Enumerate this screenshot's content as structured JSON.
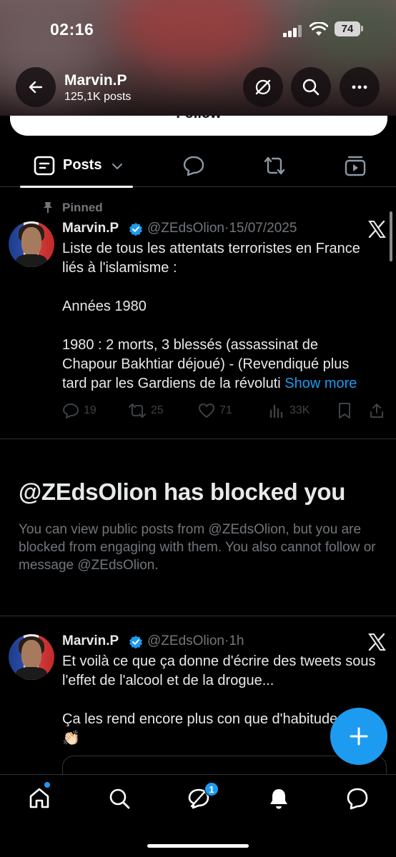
{
  "status_bar": {
    "time": "02:16",
    "battery": "74"
  },
  "header": {
    "profile_name": "Marvin.P",
    "post_count": "125,1K posts",
    "follow_label": "Follow"
  },
  "tabs": {
    "active_label": "Posts"
  },
  "pinned_tweet": {
    "pinned_label": "Pinned",
    "author": "Marvin.P",
    "handle": "@ZEdsOlion",
    "date_sep": "·",
    "date": "15/07/2025",
    "text": "Liste de tous les attentats terroristes en France liés à l'islamisme :\n\nAnnées 1980\n\n1980 : 2 morts, 3 blessés (assassinat de Chapour Bakhtiar déjoué) - (Revendiqué plus tard par les Gardiens de la révoluti ",
    "show_more": "Show more",
    "replies": "19",
    "reposts": "25",
    "likes": "71",
    "views": "33K"
  },
  "blocked": {
    "title": "@ZEdsOlion has blocked you",
    "description": "You can view public posts from @ZEdsOlion, but you are blocked from engaging with them. You also cannot follow or message @ZEdsOlion."
  },
  "second_tweet": {
    "author": "Marvin.P",
    "handle": "@ZEdsOlion",
    "date_sep": "·",
    "time": "1h",
    "text": "Et voilà ce que ça donne d'écrire des tweets sous l'effet de l'alcool et de la drogue...\n\nÇa les rend encore plus con que d'habitude\n👏🏻"
  },
  "bottom_nav": {
    "messages_badge": "1"
  },
  "colors": {
    "accent": "#1d9bf0",
    "muted": "#71767b",
    "divider": "#2f3336",
    "background": "#000000"
  },
  "icons": [
    "back-arrow-icon",
    "grok-icon",
    "search-icon",
    "more-icon",
    "posts-tab-icon",
    "chevron-down-icon",
    "replies-tab-icon",
    "reposts-tab-icon",
    "media-tab-icon",
    "pin-icon",
    "verified-icon",
    "x-logo-icon",
    "reply-icon",
    "repost-icon",
    "like-icon",
    "views-icon",
    "bookmark-icon",
    "share-icon",
    "plus-icon",
    "home-icon",
    "explore-icon",
    "grok-nav-icon",
    "bell-icon",
    "messages-icon"
  ]
}
